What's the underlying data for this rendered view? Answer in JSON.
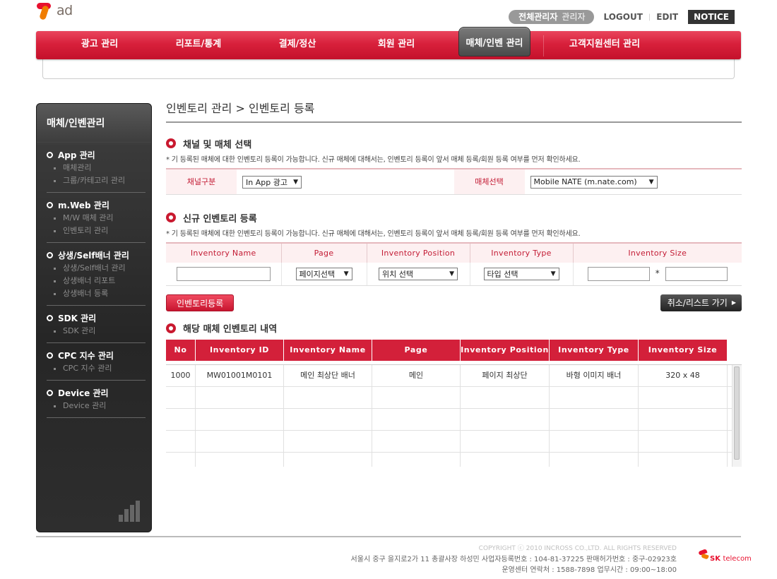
{
  "header": {
    "logo_text": "ad",
    "admin_label": "전체관리자",
    "admin_role": "관리자",
    "logout": "LOGOUT",
    "edit": "EDIT",
    "notice": "NOTICE"
  },
  "nav": {
    "items": [
      {
        "label": "광고 관리"
      },
      {
        "label": "리포트/통계"
      },
      {
        "label": "결제/정산"
      },
      {
        "label": "회원 관리"
      },
      {
        "label": "매체/인벤 관리"
      },
      {
        "label": "고객지원센터 관리"
      }
    ],
    "active_index": 4
  },
  "sidebar": {
    "title": "매체/인벤관리",
    "groups": [
      {
        "label": "App 관리",
        "subs": [
          "매체관리",
          "그룹/카테고리 관리"
        ]
      },
      {
        "label": "m.Web 관리",
        "subs": [
          "M/W 매체 관리",
          "인벤토리 관리"
        ]
      },
      {
        "label": "상생/Self배너 관리",
        "subs": [
          "상생/Self배너 관리",
          "상생배너 리포트",
          "상생배너 등록"
        ]
      },
      {
        "label": "SDK 관리",
        "subs": [
          "SDK 관리"
        ]
      },
      {
        "label": "CPC 지수 관리",
        "subs": [
          "CPC 지수 관리"
        ]
      },
      {
        "label": "Device 관리",
        "subs": [
          "Device 관리"
        ]
      }
    ]
  },
  "page": {
    "title": "인벤토리 관리 > 인벤토리 등록",
    "section1": {
      "title": "채널 및 매체 선택",
      "desc": "* 기 등록된 매체에 대한 인벤토리 등록이 가능합니다. 신규 매체에 대해서는, 인벤토리 등록이 앞서 매체 등록/회원 등록 여부를 먼저 확인하세요.",
      "channel_label": "채널구분",
      "channel_value": "In App 광고",
      "media_label": "매체선택",
      "media_value": "Mobile NATE (m.nate.com)"
    },
    "section2": {
      "title": "신규 인벤토리 등록",
      "desc": "* 기 등록된 매체에 대한 인벤토리 등록이 가능합니다. 신규 매체에 대해서는, 인벤토리 등록이 앞서 매체 등록/회원 등록 여부를 먼저 확인하세요.",
      "headers": [
        "Inventory Name",
        "Page",
        "Inventory Position",
        "Inventory Type",
        "Inventory Size"
      ],
      "page_select": "페이지선택",
      "position_select": "위치 선택",
      "type_select": "타입 선택",
      "size_separator": "*",
      "register_button": "인벤토리등록",
      "cancel_button": "취소/리스트 가기"
    },
    "section3": {
      "title": "해당 매체 인벤토리 내역",
      "headers": [
        "No",
        "Inventory ID",
        "Inventory Name",
        "Page",
        "Inventory Position",
        "Inventory Type",
        "Inventory Size"
      ],
      "rows": [
        [
          "1000",
          "MW01001M0101",
          "메인 최상단 배너",
          "메인",
          "페이지 최상단",
          "바형 이미지 배너",
          "320 x 48"
        ]
      ]
    }
  },
  "footer": {
    "copyright": "COPYRIGHT ⓒ 2010 INCROSS CO.,LTD. ALL RIGHTS RESERVED",
    "address": "서울시 중구 을지로2가 11 총괄사장 하성민  사업자등록번호 : 104-81-37225  판매허가번호 : 중구-02923호",
    "center": "운영센터 연락처 : 1588-7898  업무시간 : 09:00~18:00",
    "sk_logo": "SK",
    "sk_tel": "telecom"
  }
}
